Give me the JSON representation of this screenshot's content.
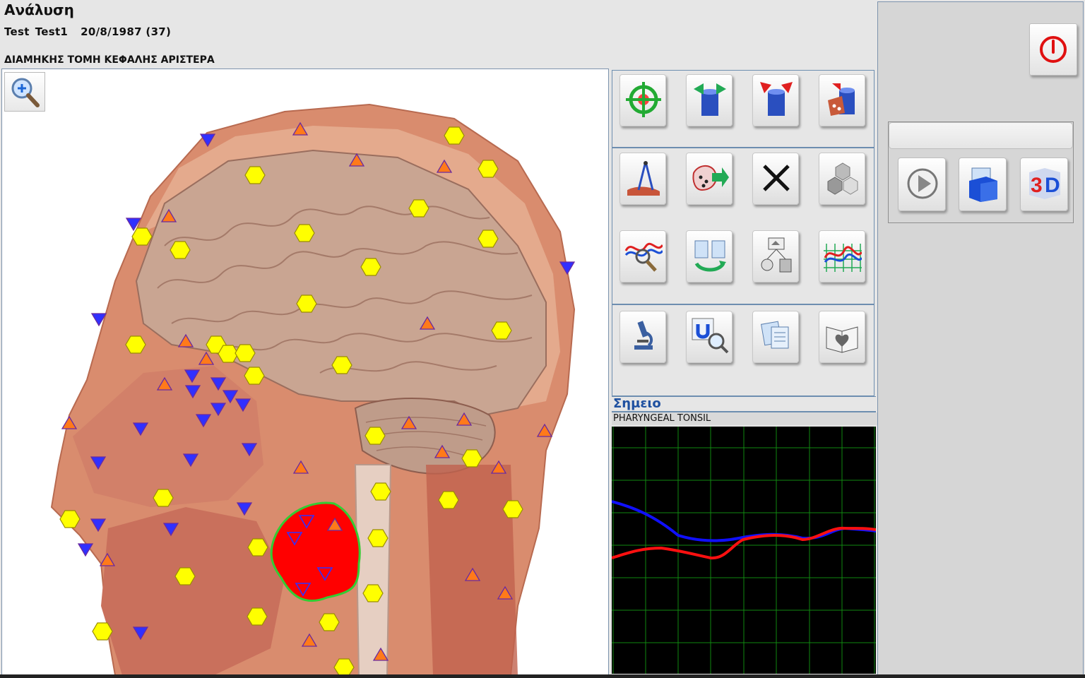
{
  "header": {
    "title": "Ανάλυση",
    "patient_first": "Test",
    "patient_last": "Test1",
    "patient_dob": "20/8/1987 (37)",
    "section": "ΔΙΑΜΗΚΗΣ ΤΟΜΗ ΚΕΦΑΛΗΣ ΑΡΙΣΤΕΡΑ"
  },
  "image_panel": {
    "zoom_icon": "zoom-in-icon"
  },
  "toolbar": {
    "icons": [
      "target-icon",
      "cylinder-arrows-out-icon",
      "cylinder-arrows-in-icon",
      "cylinder-pattern-icon",
      "compass-tool-icon",
      "region-arrow-icon",
      "close-icon",
      "cubes-icon",
      "wave-magnifier-icon",
      "cycle-documents-icon",
      "scan-diagram-icon",
      "waveform-grid-icon",
      "microscope-icon",
      "magnet-magnifier-icon",
      "documents-icon",
      "book-heart-icon"
    ]
  },
  "point": {
    "header": "Σημειο",
    "name": "PHARYNGEAL TONSIL"
  },
  "colors": {
    "graph_background": "#000000",
    "grid": "#118811",
    "series_blue": "#1010ff",
    "series_red": "#ff1010",
    "highlight_region": "#ff0000",
    "highlight_outline": "#33cc33"
  },
  "right_panel": {
    "power_icon": "power-icon",
    "media_icons": [
      "play-icon",
      "folder-box-icon",
      "3d-icon"
    ]
  }
}
